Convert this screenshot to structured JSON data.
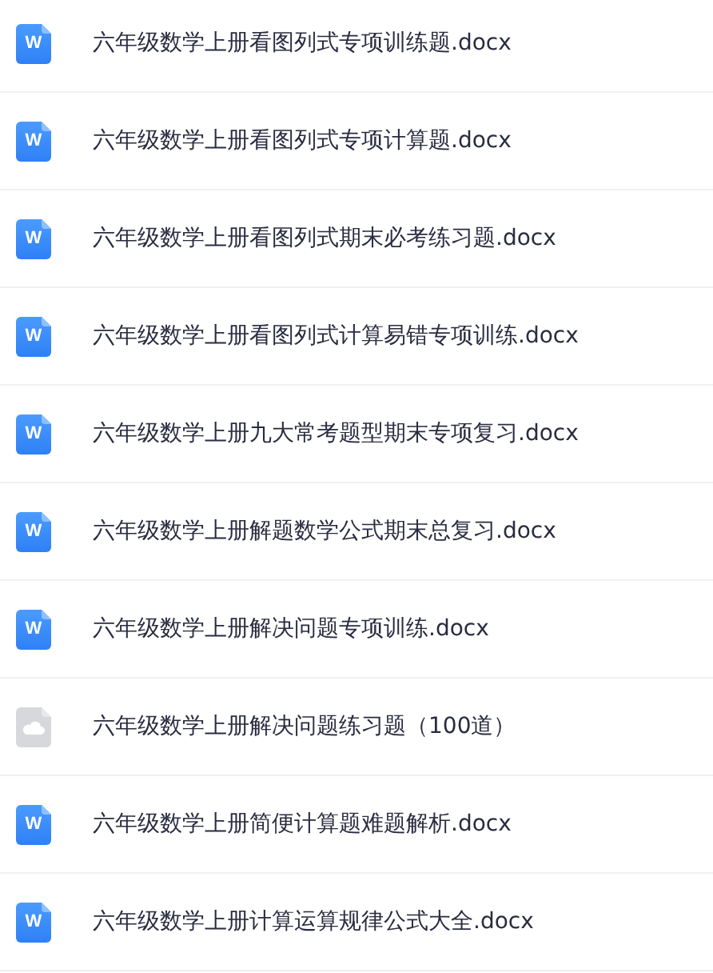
{
  "files": [
    {
      "name": "六年级数学上册看图列式专项训练题.docx",
      "icon": {
        "kind": "word",
        "letter": "W"
      }
    },
    {
      "name": "六年级数学上册看图列式专项计算题.docx",
      "icon": {
        "kind": "word",
        "letter": "W"
      }
    },
    {
      "name": "六年级数学上册看图列式期末必考练习题.docx",
      "icon": {
        "kind": "word",
        "letter": "W"
      }
    },
    {
      "name": "六年级数学上册看图列式计算易错专项训练.docx",
      "icon": {
        "kind": "word",
        "letter": "W"
      }
    },
    {
      "name": "六年级数学上册九大常考题型期末专项复习.docx",
      "icon": {
        "kind": "word",
        "letter": "W"
      }
    },
    {
      "name": "六年级数学上册解题数学公式期末总复习.docx",
      "icon": {
        "kind": "word",
        "letter": "W"
      }
    },
    {
      "name": "六年级数学上册解决问题专项训练.docx",
      "icon": {
        "kind": "word",
        "letter": "W"
      }
    },
    {
      "name": "六年级数学上册解决问题练习题（100道）",
      "icon": {
        "kind": "cloud"
      }
    },
    {
      "name": "六年级数学上册简便计算题难题解析.docx",
      "icon": {
        "kind": "word",
        "letter": "W"
      }
    },
    {
      "name": "六年级数学上册计算运算规律公式大全.docx",
      "icon": {
        "kind": "word",
        "letter": "W"
      }
    }
  ]
}
